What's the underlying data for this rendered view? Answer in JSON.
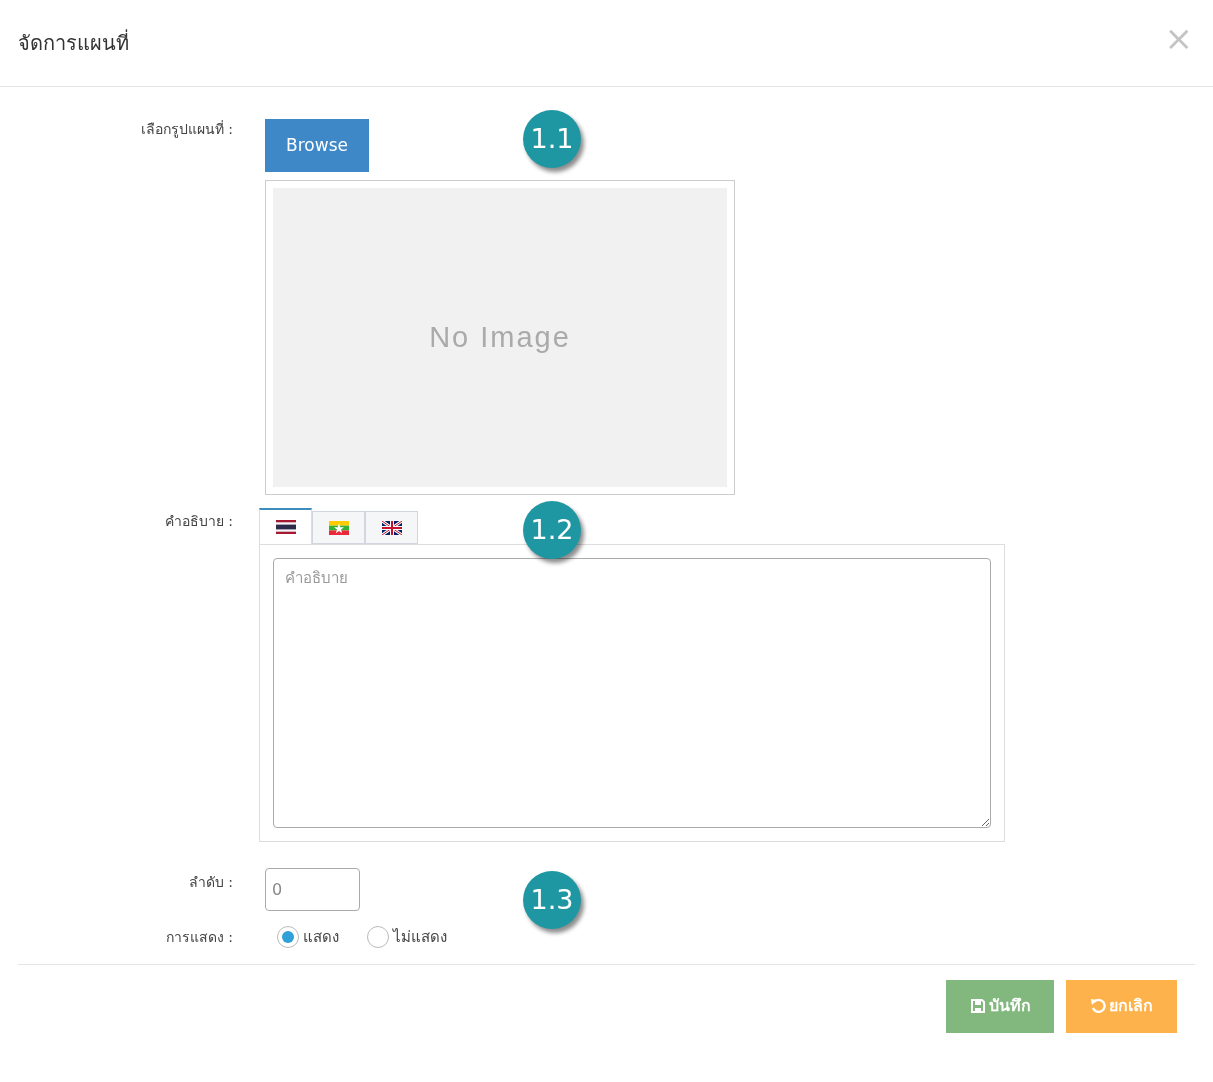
{
  "dialog": {
    "title": "จัดการแผนที่",
    "close": "×"
  },
  "map_image": {
    "label": "เลือกรูปแผนที่ :",
    "button": "Browse",
    "preview": "No Image"
  },
  "description": {
    "label": "คำอธิบาย :",
    "tabs": [
      {
        "kind": "thai",
        "selected": true
      },
      {
        "kind": "myanmar",
        "selected": false
      },
      {
        "kind": "uk",
        "selected": false
      }
    ],
    "placeholder": "คำอธิบาย"
  },
  "order": {
    "label": "ลำดับ :",
    "value": "0"
  },
  "display": {
    "label": "การแสดง :",
    "options": [
      {
        "label": "แสดง",
        "selected": true
      },
      {
        "label": "ไม่แสดง",
        "selected": false
      }
    ]
  },
  "buttons": [
    {
      "kind": "save",
      "label": "บันทึก"
    },
    {
      "kind": "cancel",
      "label": "ยกเลิก"
    }
  ],
  "callouts": [
    "1.1",
    "1.2",
    "1.3"
  ]
}
